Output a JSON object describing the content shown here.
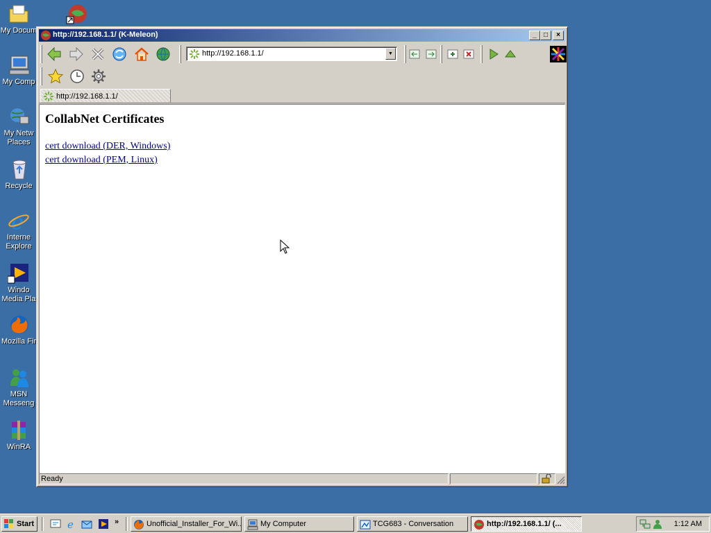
{
  "desktop": {
    "icons": [
      {
        "label": "My Docum",
        "icon": "folder-documents-icon"
      },
      {
        "label": "",
        "icon": "shortcut-app-icon"
      },
      {
        "label": "My Comp",
        "icon": "my-computer-icon"
      },
      {
        "label": "My Netw Places",
        "icon": "network-places-icon"
      },
      {
        "label": "Recycle",
        "icon": "recycle-bin-icon"
      },
      {
        "label": "Interne Explore",
        "icon": "internet-explorer-icon"
      },
      {
        "label": "Windo Media Pla",
        "icon": "media-player-icon"
      },
      {
        "label": "Mozilla Fir",
        "icon": "firefox-icon"
      },
      {
        "label": "MSN Messeng",
        "icon": "msn-messenger-icon"
      },
      {
        "label": "WinRA",
        "icon": "winrar-icon"
      }
    ]
  },
  "window": {
    "title": "http://192.168.1.1/ (K-Meleon)",
    "controls": {
      "minimize": "_",
      "maximize": "□",
      "close": "×"
    },
    "address": {
      "url": "http://192.168.1.1/"
    },
    "tab": {
      "label": "http://192.168.1.1/"
    },
    "page": {
      "heading": "CollabNet Certificates",
      "links": [
        "cert download (DER, Windows)",
        "cert download (PEM, Linux)"
      ]
    },
    "status": {
      "text": "Ready"
    }
  },
  "taskbar": {
    "start_label": "Start",
    "tasks": [
      {
        "label": "Unofficial_Installer_For_Wi...",
        "active": false
      },
      {
        "label": "My Computer",
        "active": false
      },
      {
        "label": "TCG683 - Conversation",
        "active": false
      },
      {
        "label": "http://192.168.1.1/ (...",
        "active": true
      }
    ],
    "clock": "1:12 AM"
  },
  "colors": {
    "desktop": "#3a6ea5",
    "titlebar_start": "#0a246a",
    "titlebar_end": "#a6caf0",
    "link": "#00008b"
  }
}
